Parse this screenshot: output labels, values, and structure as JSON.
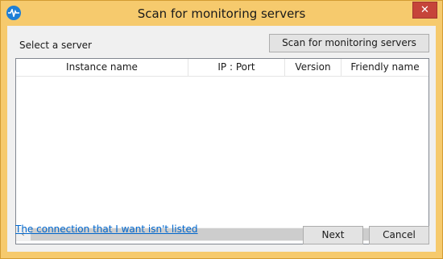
{
  "window": {
    "title": "Scan for monitoring servers",
    "close_glyph": "✕",
    "app_icon": "pulse-icon",
    "frame_color": "#f6ca6d",
    "close_color": "#c6443a"
  },
  "main": {
    "select_label": "Select a server",
    "scan_button": "Scan for monitoring servers",
    "table": {
      "columns": [
        "Instance name",
        "IP : Port",
        "Version",
        "Friendly name"
      ],
      "rows": []
    },
    "scrollbar": {
      "left_arrow": "‹",
      "right_arrow": "›"
    },
    "link": "The connection that I want isn't listed",
    "next_button": "Next",
    "cancel_button": "Cancel"
  }
}
